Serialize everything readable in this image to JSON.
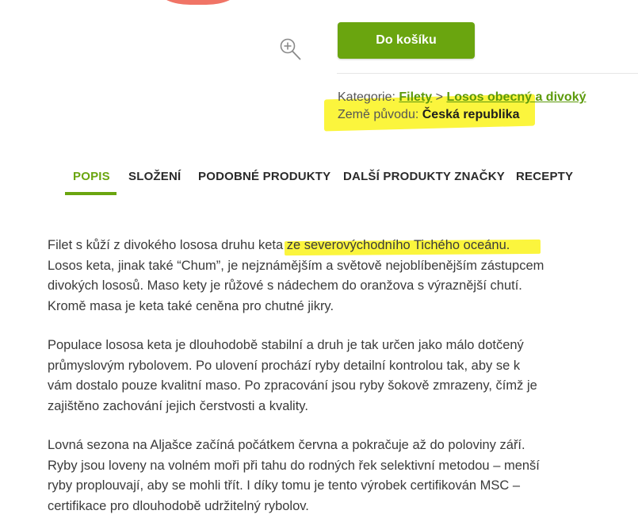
{
  "product": {
    "add_to_cart_label": "Do košíku",
    "zoom_icon": "zoom-in-icon",
    "category_label": "Kategorie:",
    "categories": [
      "Filety",
      "Losos obecný a divoký"
    ],
    "category_separator": ">",
    "origin_label": "Země původu:",
    "origin_value": "Česká republika",
    "brand_color": "#6aa50f",
    "highlight_color": "#fbf53d"
  },
  "tabs": [
    {
      "label": "POPIS",
      "active": true
    },
    {
      "label": "SLOŽENÍ",
      "active": false
    },
    {
      "label": "PODOBNÉ PRODUKTY",
      "active": false
    },
    {
      "label": "DALŠÍ PRODUKTY ZNAČKY",
      "active": false
    },
    {
      "label": "RECEPTY",
      "active": false
    }
  ],
  "description": {
    "p1": [
      "Filet s kůží z divokého lososa druhu keta ",
      "ze severovýchodního Tichého oceánu.",
      "Losos keta, jinak také “Chum”, je nejznámějším a světově nejoblíbenějším zástupcem",
      "divokých lososů. Maso kety je růžové s nádechem do oranžova s výraznější chutí.",
      "Kromě masa je keta také ceněna pro chutné jikry."
    ],
    "p2": [
      "Populace lososa keta je dlouhodobě stabilní a druh je tak určen jako málo dotčený",
      "průmyslovým rybolovem. Po ulovení prochází ryby detailní kontrolou tak, aby se k",
      "vám dostalo pouze kvalitní maso. Po zpracování jsou ryby šokově zmrazeny, čímž je",
      "zajištěno zachování jejich čerstvosti a kvality."
    ],
    "p3": [
      "Lovná sezona na Aljašce začíná počátkem června a pokračuje až do poloviny září.",
      "Ryby jsou loveny na volném moři při tahu do rodných řek selektivní metodou – menší",
      "ryby proplouvají, aby se mohli třít. I díky tomu je tento výrobek certifikován MSC –",
      "certifikace pro dlouhodobě udržitelný rybolov."
    ]
  }
}
